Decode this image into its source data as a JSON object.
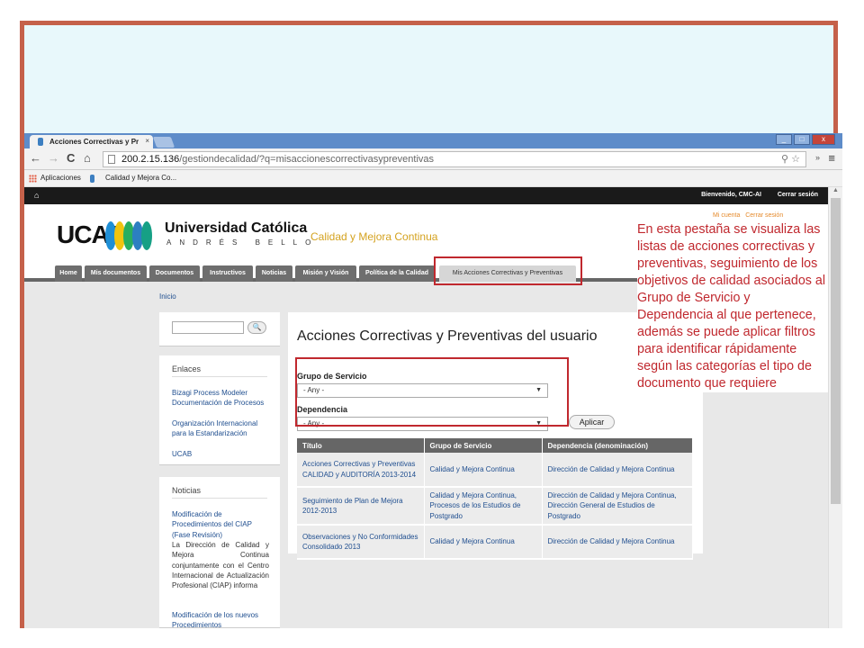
{
  "browser": {
    "tab_title": "Acciones Correctivas y Pr",
    "tab_close": "×",
    "url_host": "200.2.15.136",
    "url_path": "/gestiondecalidad/?q=misaccionescorrectivasypreventivas",
    "bookmarks": [
      "Aplicaciones",
      "Calidad y Mejora Co..."
    ],
    "nav_back": "←",
    "nav_forward": "→",
    "nav_reload": "C",
    "nav_home": "⌂",
    "url_tools": "⚲ ☆",
    "extra": "»",
    "menu": "≡",
    "win_min": "_",
    "win_max": "□",
    "win_close": "x"
  },
  "site": {
    "home_icon": "⌂",
    "welcome": "Bienvenido, CMC-AI",
    "logout": "Cerrar sesión",
    "my_account": "Mi cuenta",
    "logout_small": "Cerrar sesión",
    "logo": "UCAB",
    "university_name": "Universidad Católica",
    "university_sub": "ANDRÉS BELLO",
    "section_title": "Calidad y Mejora Continua",
    "nav_tabs": [
      "Home",
      "Mis documentos",
      "Documentos",
      "Instructivos",
      "Noticias",
      "Misión y Visión",
      "Política de la Calidad",
      "Mis Acciones Correctivas y Preventivas"
    ],
    "breadcrumb": "Inicio"
  },
  "sidebar": {
    "search_icon": "🔍",
    "links_heading": "Enlaces",
    "links": [
      "Bizagi Process Modeler",
      "Documentación de Procesos",
      "Organización Internacional para la Estandarización",
      "UCAB"
    ],
    "news_heading": "Noticias",
    "news1_title": "Modificación de Procedimientos del CIAP (Fase Revisión)",
    "news1_text": "La Dirección de Calidad y Mejora Continua conjuntamente con el Centro Internacional de Actualización Profesional (CIAP) informa",
    "news2_title": "Modificación de los nuevos Procedimientos"
  },
  "main": {
    "title": "Acciones Correctivas y Preventivas del usuario",
    "filter1_label": "Grupo de Servicio",
    "filter1_value": "- Any -",
    "filter2_label": "Dependencia",
    "filter2_value": "- Any -",
    "apply": "Aplicar",
    "table": {
      "headers": [
        "Título",
        "Grupo de Servicio",
        "Dependencia (denominación)"
      ],
      "rows": [
        [
          "Acciones Correctivas y Preventivas CALIDAD y AUDITORÍA 2013-2014",
          "Calidad y Mejora Continua",
          "Dirección de Calidad y Mejora Continua"
        ],
        [
          "Seguimiento de Plan de Mejora 2012-2013",
          "Calidad y Mejora Continua, Procesos de los Estudios de Postgrado",
          "Dirección de Calidad y Mejora Continua, Dirección General de Estudios de Postgrado"
        ],
        [
          "Observaciones y No Conformidades Consolidado 2013",
          "Calidad y Mejora Continua",
          "Dirección de Calidad y Mejora Continua"
        ]
      ]
    }
  },
  "annotation": "En esta pestaña se visualiza las listas de acciones correctivas y preventivas, seguimiento de los objetivos de calidad asociados al Grupo de Servicio y Dependencia al que pertenece, además se puede aplicar filtros para identificar rápidamente según las categorías el tipo de documento que requiere",
  "colors": {
    "frame": "#c5614a",
    "highlight": "#c0282e",
    "annotation": "#c0282e",
    "accent": "#d4a21f"
  }
}
